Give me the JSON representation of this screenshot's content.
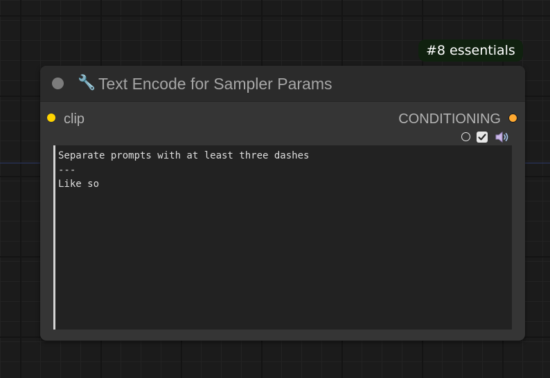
{
  "badge": {
    "text": "#8 essentials"
  },
  "node": {
    "title_icon": "wrench-icon",
    "title_icon_glyph": "🔧",
    "title": "Text Encode for Sampler Params",
    "inputs": [
      {
        "label": "clip",
        "color": "#ffd400"
      }
    ],
    "outputs": [
      {
        "label": "CONDITIONING",
        "color": "#ffa931"
      }
    ],
    "text_widget": {
      "value": "Separate prompts with at least three dashes\n---\nLike so"
    },
    "mini_icons": [
      "circle-icon",
      "checkbox-icon",
      "speaker-icon"
    ]
  },
  "colors": {
    "canvas_bg": "#1b1b1b",
    "node_bg": "#353535",
    "title_bg": "#2b2b2b",
    "badge_bg": "#10210f",
    "link": "#2e3a6a"
  }
}
